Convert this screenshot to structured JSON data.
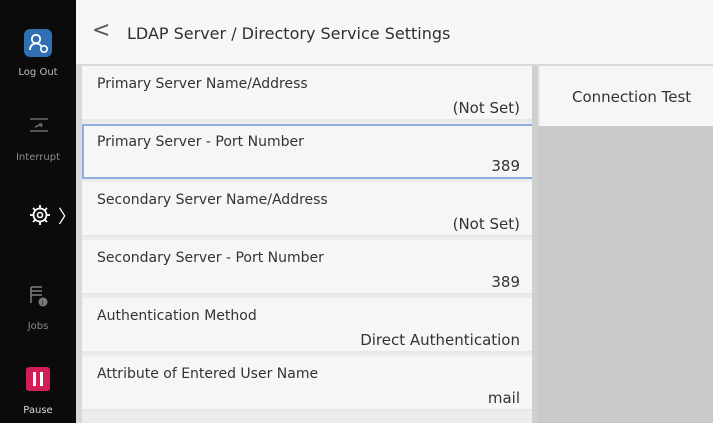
{
  "sidebar": {
    "logout_label": "Log Out",
    "interrupt_label": "Interrupt",
    "jobs_label": "Jobs",
    "pause_label": "Pause"
  },
  "header": {
    "title": "LDAP Server / Directory Service Settings"
  },
  "settings": [
    {
      "label": "Primary Server Name/Address",
      "value": "(Not Set)"
    },
    {
      "label": "Primary Server - Port Number",
      "value": "389"
    },
    {
      "label": "Secondary Server Name/Address",
      "value": "(Not Set)"
    },
    {
      "label": "Secondary Server - Port Number",
      "value": "389"
    },
    {
      "label": "Authentication Method",
      "value": "Direct Authentication"
    },
    {
      "label": "Attribute of Entered User Name",
      "value": "mail"
    }
  ],
  "right_panel": {
    "connection_test_label": "Connection Test"
  },
  "colors": {
    "accent_blue": "#2f6fb2",
    "pause_red": "#d31d55",
    "selection_border": "#8faee0"
  }
}
